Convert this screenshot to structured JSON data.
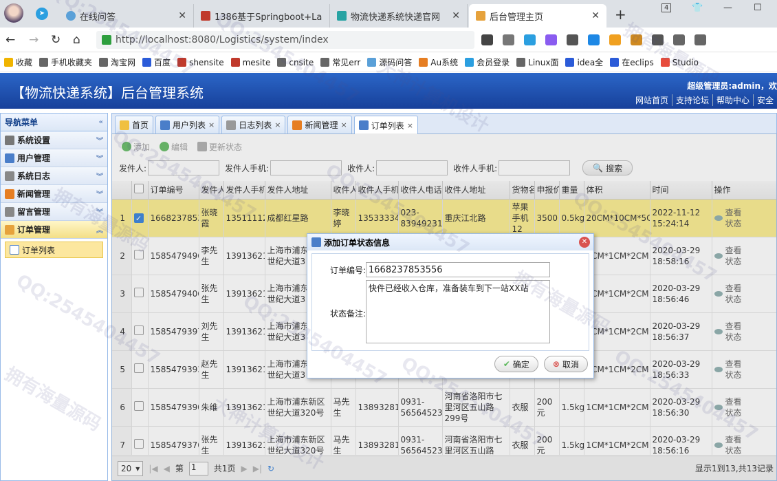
{
  "browser": {
    "tabs": [
      {
        "label": "在线问答",
        "icon": "question-icon",
        "color": "#5aa0d8"
      },
      {
        "label": "1386基于Springboot+La",
        "icon": "site-icon",
        "color": "#c0392b"
      },
      {
        "label": "物流快递系统快递官网",
        "icon": "logistics-icon",
        "color": "#27a3a3"
      },
      {
        "label": "后台管理主页",
        "icon": "admin-icon",
        "color": "#e6a23c"
      }
    ],
    "tab_count": "4",
    "url": "http://localhost:8080/Logistics/system/index"
  },
  "bookmarks": [
    {
      "label": "收藏",
      "color": "#f0b400"
    },
    {
      "label": "手机收藏夹",
      "color": "#666"
    },
    {
      "label": "淘宝网",
      "color": "#666"
    },
    {
      "label": "百度",
      "color": "#2b5bd8"
    },
    {
      "label": "shensite",
      "color": "#c0392b"
    },
    {
      "label": "mesite",
      "color": "#c0392b"
    },
    {
      "label": "cnsite",
      "color": "#666"
    },
    {
      "label": "常见err",
      "color": "#666"
    },
    {
      "label": "源码问答",
      "color": "#5aa0d8"
    },
    {
      "label": "Au系统",
      "color": "#e67e22"
    },
    {
      "label": "会员登录",
      "color": "#2b9fe0"
    },
    {
      "label": "Linux面",
      "color": "#666"
    },
    {
      "label": "idea全",
      "color": "#2b5bd8"
    },
    {
      "label": "在eclips",
      "color": "#2b5bd8"
    },
    {
      "label": "Studio",
      "color": "#e74c3c"
    }
  ],
  "app": {
    "title": "【物流快递系统】后台管理系统",
    "user": "超级管理员:admin，欢",
    "links": [
      "网站首页",
      "支持论坛",
      "帮助中心",
      "安全"
    ]
  },
  "sidebar": {
    "title": "导航菜单",
    "items": [
      {
        "label": "系统设置",
        "color": "#777"
      },
      {
        "label": "用户管理",
        "color": "#4a7ec9"
      },
      {
        "label": "系统日志",
        "color": "#888"
      },
      {
        "label": "新闻管理",
        "color": "#e67e22"
      },
      {
        "label": "留言管理",
        "color": "#888"
      },
      {
        "label": "订单管理",
        "color": "#e6a23c"
      }
    ],
    "sub_item": "订单列表"
  },
  "page_tabs": [
    {
      "label": "首页"
    },
    {
      "label": "用户列表"
    },
    {
      "label": "日志列表"
    },
    {
      "label": "新闻管理"
    },
    {
      "label": "订单列表"
    }
  ],
  "toolbar": {
    "add": "添加",
    "edit": "编辑",
    "update_status": "更新状态"
  },
  "search": {
    "sender": "发件人:",
    "sender_phone": "发件人手机:",
    "receiver": "收件人:",
    "receiver_phone": "收件人手机:",
    "button": "搜索"
  },
  "grid": {
    "columns": [
      "订单编号",
      "发件人",
      "发件人手机",
      "发件人地址",
      "收件人",
      "收件人手机",
      "收件人电话",
      "收件人地址",
      "货物名",
      "申报价",
      "重量",
      "体积",
      "时间",
      "操作"
    ],
    "rows": [
      {
        "n": "1",
        "checked": true,
        "id": "1668237853",
        "sender": "张晓霞",
        "sphone": "13511112",
        "saddr": "成都红星路",
        "receiver": "李晓婷",
        "rphone": "13533334",
        "rtel": "023-83949231",
        "raddr": "重庆江北路",
        "goods": "苹果手机12",
        "price": "3500",
        "weight": "0.5kg",
        "volume": "20CM*10CM*5C",
        "time": "2022-11-12 15:24:14",
        "op": "查看状态"
      },
      {
        "n": "2",
        "checked": false,
        "id": "1585479496",
        "sender": "李先生",
        "sphone": "13913621",
        "saddr": "上海市浦东新区世纪大道3",
        "receiver": "",
        "rphone": "",
        "rtel": "",
        "raddr": "",
        "goods": "",
        "price": "",
        "weight": "",
        "volume": "1CM*1CM*2CM",
        "time": "2020-03-29 18:58:16",
        "op": "查看状态"
      },
      {
        "n": "3",
        "checked": false,
        "id": "1585479406",
        "sender": "张先生",
        "sphone": "13913621",
        "saddr": "上海市浦东新区世纪大道3",
        "receiver": "",
        "rphone": "",
        "rtel": "",
        "raddr": "",
        "goods": "",
        "price": "",
        "weight": "",
        "volume": "1CM*1CM*2CM",
        "time": "2020-03-29 18:56:46",
        "op": "查看状态"
      },
      {
        "n": "4",
        "checked": false,
        "id": "1585479397",
        "sender": "刘先生",
        "sphone": "13913621",
        "saddr": "上海市浦东新区世纪大道3",
        "receiver": "",
        "rphone": "",
        "rtel": "",
        "raddr": "",
        "goods": "",
        "price": "",
        "weight": "",
        "volume": "1CM*1CM*2CM",
        "time": "2020-03-29 18:56:37",
        "op": "查看状态"
      },
      {
        "n": "5",
        "checked": false,
        "id": "1585479393",
        "sender": "赵先生",
        "sphone": "13913621",
        "saddr": "上海市浦东新区世纪大道3",
        "receiver": "",
        "rphone": "",
        "rtel": "",
        "raddr": "299号",
        "goods": "",
        "price": "",
        "weight": "",
        "volume": "1CM*1CM*2CM",
        "time": "2020-03-29 18:56:33",
        "op": "查看状态"
      },
      {
        "n": "6",
        "checked": false,
        "id": "1585479390",
        "sender": "朱维",
        "sphone": "13913621",
        "saddr": "上海市浦东新区世纪大道320号",
        "receiver": "马先生",
        "rphone": "13893281",
        "rtel": "0931-56564523",
        "raddr": "河南省洛阳市七里河区五山路299号",
        "goods": "衣服",
        "price": "200元",
        "weight": "1.5kg",
        "volume": "1CM*1CM*2CM",
        "time": "2020-03-29 18:56:30",
        "op": "查看状态"
      },
      {
        "n": "7",
        "checked": false,
        "id": "1585479376",
        "sender": "张先生",
        "sphone": "13913621",
        "saddr": "上海市浦东新区世纪大道320号",
        "receiver": "马先生",
        "rphone": "13893281",
        "rtel": "0931-56564523",
        "raddr": "河南省洛阳市七里河区五山路",
        "goods": "衣服",
        "price": "200元",
        "weight": "1.5kg",
        "volume": "1CM*1CM*2CM",
        "time": "2020-03-29 18:56:16",
        "op": "查看状态"
      }
    ]
  },
  "pager": {
    "page_size": "20",
    "page_prefix": "第",
    "page": "1",
    "page_suffix": "共1页",
    "info": "显示1到13,共13记录"
  },
  "dialog": {
    "title": "添加订单状态信息",
    "order_label": "订单编号:",
    "order_value": "1668237853556",
    "remark_label": "状态备注:",
    "remark_value": "快件已经收入仓库，准备装车到下一站XX站",
    "ok": "确定",
    "cancel": "取消"
  },
  "watermarks": [
    "QQ:2545404457",
    "拥有海量源码",
    "大神计算机设计"
  ]
}
